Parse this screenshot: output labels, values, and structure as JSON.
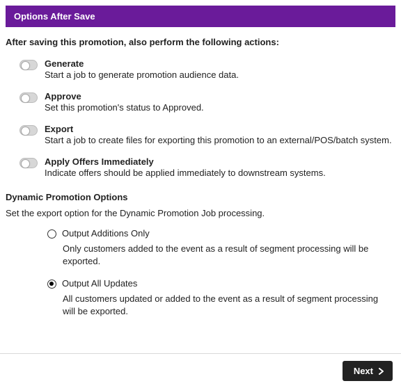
{
  "panel": {
    "title": "Options After Save"
  },
  "intro": "After saving this promotion, also perform the following actions:",
  "toggles": [
    {
      "title": "Generate",
      "desc": "Start a job to generate promotion audience data."
    },
    {
      "title": "Approve",
      "desc": "Set this promotion's status to Approved."
    },
    {
      "title": "Export",
      "desc": "Start a job to create files for exporting this promotion to an external/POS/batch system."
    },
    {
      "title": "Apply Offers Immediately",
      "desc": "Indicate offers should be applied immediately to downstream systems."
    }
  ],
  "dynamic": {
    "heading": "Dynamic Promotion Options",
    "sub": "Set the export option for the Dynamic Promotion Job processing.",
    "options": [
      {
        "label": "Output Additions Only",
        "desc": "Only customers added to the event as a result of segment processing will be exported.",
        "selected": false
      },
      {
        "label": "Output All Updates",
        "desc": "All customers updated or added to the event as a result of segment processing will be exported.",
        "selected": true
      }
    ]
  },
  "footer": {
    "next_label": "Next"
  }
}
